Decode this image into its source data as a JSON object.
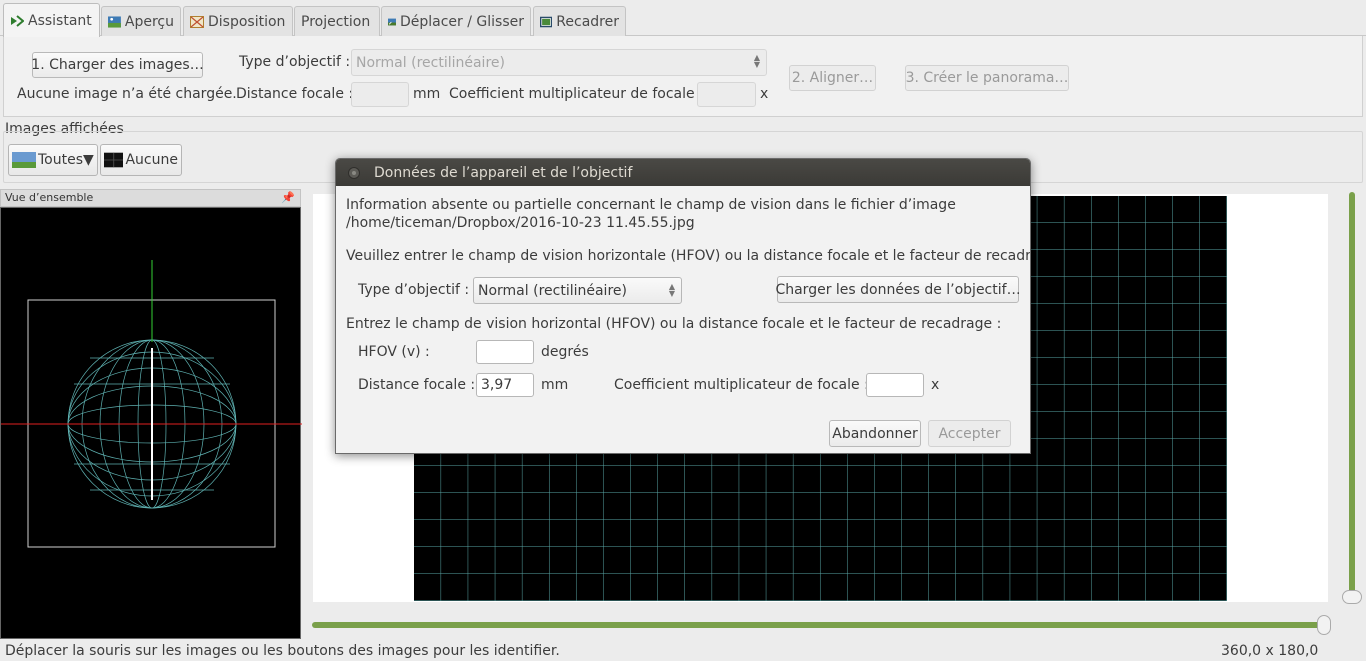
{
  "tabs": [
    {
      "label": "Assistant",
      "icon": "wizard-icon",
      "active": true
    },
    {
      "label": "Aperçu",
      "icon": "preview-icon"
    },
    {
      "label": "Disposition",
      "icon": "layout-icon"
    },
    {
      "label": "Projection",
      "icon": ""
    },
    {
      "label": "Déplacer / Glisser",
      "icon": "move-drag-icon"
    },
    {
      "label": "Recadrer",
      "icon": "crop-icon"
    }
  ],
  "assistant": {
    "load_button": "1. Charger des images…",
    "no_image_text": "Aucune image n’a été chargée.",
    "lens_type_label": "Type d’objectif :",
    "lens_type_value": "Normal (rectilinéaire)",
    "focal_length_label": "Distance focale :",
    "focal_length_value": "",
    "focal_unit": "mm",
    "crop_factor_label": "Coefficient multiplicateur de focale :",
    "crop_factor_value": "",
    "crop_unit": "x",
    "align_button": "2. Aligner…",
    "create_button": "3. Créer le panorama…"
  },
  "images": {
    "section_label": "Images affichées",
    "all_button": "Toutes▼",
    "none_button": "Aucune"
  },
  "overview": {
    "title": "Vue d’ensemble"
  },
  "dialog": {
    "title": "Données de l’appareil et de l’objectif",
    "info_line1": "Information absente ou partielle concernant le champ de vision dans le fichier d’image",
    "info_line2": "/home/ticeman/Dropbox/2016-10-23 11.45.55.jpg",
    "instruction": "Veuillez entrer le champ de vision horizontale (HFOV) ou la distance focale et le facteur de recadrage.",
    "lens_type_label": "Type d’objectif :",
    "lens_type_value": "Normal (rectilinéaire)",
    "load_lens_button": "Charger les données de l’objectif…",
    "instruction2": "Entrez le champ de vision horizontal (HFOV) ou la distance focale et le facteur de recadrage :",
    "hfov_label": "HFOV (v) :",
    "hfov_value": "",
    "hfov_unit": "degrés",
    "focal_label": "Distance focale :",
    "focal_value": "3,97",
    "focal_unit": "mm",
    "crop_label": "Coefficient multiplicateur de focale :",
    "crop_value": "",
    "crop_unit": "x",
    "cancel_button": "Abandonner",
    "accept_button": "Accepter"
  },
  "status": {
    "hint": "Déplacer la souris sur les images ou les boutons des images pour les identifier.",
    "fov": "360,0 x 180,0"
  },
  "colors": {
    "slider": "#7aa04a",
    "grid": "#6fd0d0",
    "dialog_title_bg": "#3b3a36"
  }
}
